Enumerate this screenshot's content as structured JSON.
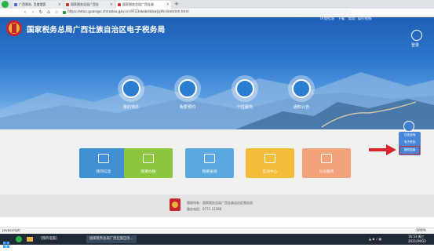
{
  "browser": {
    "tabs": [
      {
        "label": "广西税务, 百度搜索",
        "color": "#3b6fd6"
      },
      {
        "label": "国家税务总局广西壮",
        "color": "#c33"
      },
      {
        "label": "国家税务总局广西壮族",
        "color": "#c33"
      }
    ],
    "new_tab": "+",
    "url": "https://etax.guangxi.chinatax.gov.cn:9723/web/dzswj/ythclient/mh.html"
  },
  "site": {
    "title": "国家税务总局广西壮族自治区电子税务局",
    "top_links": [
      "环境检测",
      "下载",
      "帮助",
      "操作视频"
    ],
    "login": "登录",
    "quick_entries": [
      "我的待办",
      "我要预约",
      "个性服务",
      "通知公告"
    ],
    "cards": [
      {
        "label": "我的信息",
        "color": "#3f8fd4"
      },
      {
        "label": "我要办税",
        "color": "#8cc63f"
      },
      {
        "label": "我要查询",
        "color": "#5ba7e0"
      },
      {
        "label": "互动中心",
        "color": "#f3bd3a"
      },
      {
        "label": "公众服务",
        "color": "#f2a37c"
      }
    ],
    "float_menu": [
      "在线咨询",
      "电子税务",
      "操作指南"
    ],
    "footer": {
      "line1": "版权所有：国家税务总局广西壮族自治区税务局",
      "line2": "服务电话：0771-12366"
    }
  },
  "statusbar": {
    "left": "javascript:",
    "right": "100%"
  },
  "taskbar": {
    "items": [
      "[我的电脑]",
      "国家税务总局广西壮族自治..."
    ],
    "time": "16:53 周三",
    "date": "2021/09/22"
  },
  "colors": {
    "banner_blue": "#2e78cf",
    "arrow_red": "#d9262c"
  }
}
